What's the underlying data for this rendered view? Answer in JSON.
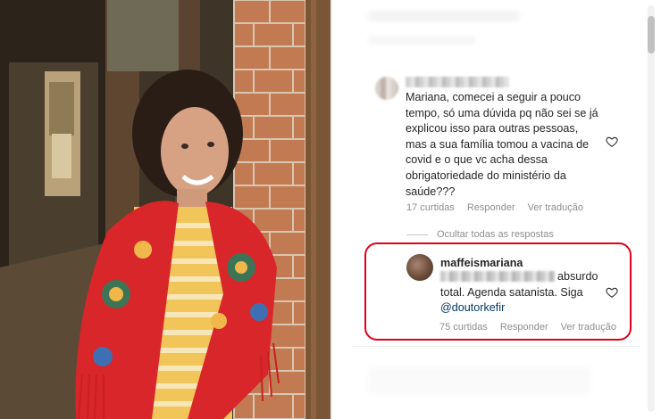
{
  "photo": {
    "alt": ""
  },
  "comments": [
    {
      "text": "Mariana, comecei a seguir a pouco tempo, só uma dúvida pq não sei se já explicou isso para outras pessoas, mas a sua família tomou a vacina de covid e o que vc acha dessa obrigatoriedade do ministério da saúde???",
      "likes": "17 curtidas",
      "reply_label": "Responder",
      "translate_label": "Ver tradução",
      "hide_replies_label": "Ocultar todas as respostas"
    }
  ],
  "reply": {
    "username": "maffeismariana",
    "text_prefix": "absurdo total. Agenda satanista. Siga ",
    "mention": "@doutorkefir",
    "likes": "75 curtidas",
    "reply_label": "Responder",
    "translate_label": "Ver tradução"
  },
  "colors": {
    "highlight": "#e0001b",
    "meta": "#8e8e8e",
    "mention": "#00376b",
    "text": "#262626"
  },
  "icons": {
    "like": "heart-icon"
  }
}
